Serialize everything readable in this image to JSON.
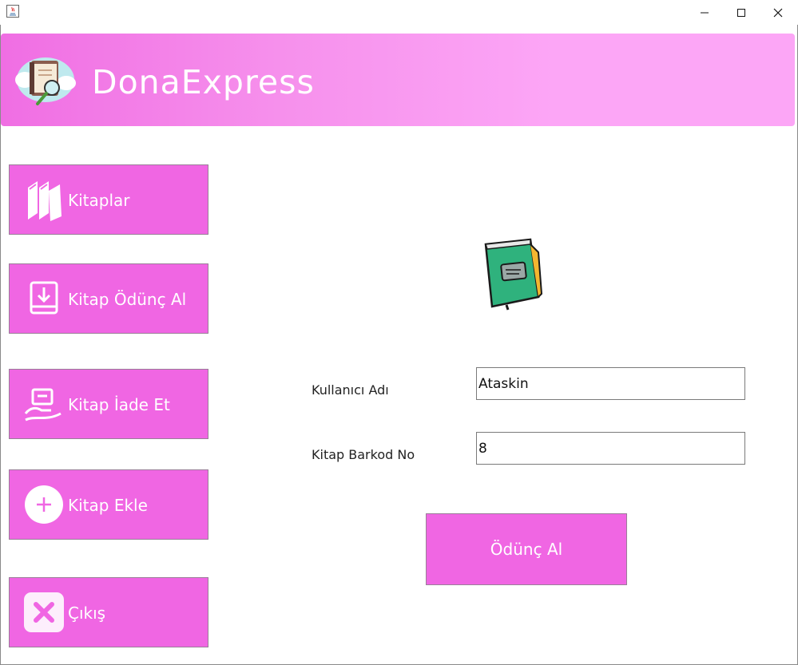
{
  "window": {
    "controls": {
      "minimize_icon": "minimize-icon",
      "maximize_icon": "maximize-icon",
      "close_icon": "close-icon"
    }
  },
  "header": {
    "title": "DonaExpress",
    "logo_icon": "book-cloud-magnifier-logo"
  },
  "sidebar": {
    "items": [
      {
        "label": "Kitaplar",
        "icon": "books-icon"
      },
      {
        "label": "Kitap Ödünç Al",
        "icon": "book-download-icon"
      },
      {
        "label": "Kitap İade Et",
        "icon": "hand-return-icon"
      },
      {
        "label": "Kitap Ekle",
        "icon": "plus-circle-icon"
      },
      {
        "label": "Çıkış",
        "icon": "close-x-icon"
      }
    ]
  },
  "main": {
    "illustration": "green-book-icon",
    "form": {
      "username_label": "Kullanıcı Adı",
      "username_value": "Ataskin",
      "barcode_label": "Kitap Barkod No",
      "barcode_value": "8",
      "submit_label": "Ödünç Al"
    }
  },
  "colors": {
    "accent": "#f066e3",
    "header_gradient_start": "#f06ee3",
    "header_gradient_end": "#fca6f6",
    "text_on_accent": "#ffffff"
  }
}
